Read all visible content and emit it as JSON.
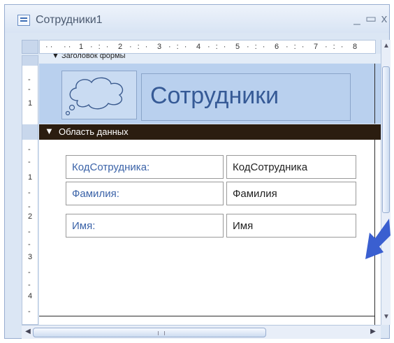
{
  "window": {
    "title": "Сотрудники1",
    "minimize_glyph": "_",
    "maximize_glyph": "▭",
    "close_glyph": "x"
  },
  "rulers": {
    "horizontal_numbers": [
      "1",
      "2",
      "3",
      "4",
      "5",
      "6",
      "7",
      "8"
    ],
    "vertical_header_numbers": [
      "1"
    ],
    "vertical_detail_numbers": [
      "1",
      "2",
      "3",
      "4"
    ]
  },
  "form_header": {
    "section_label": "▼ Заголовок формы",
    "title": "Сотрудники",
    "logo_icon": "cloud-logo-icon"
  },
  "detail_section": {
    "label": "Область данных",
    "fields": [
      {
        "label": "КодСотрудника:",
        "value": "КодСотрудника"
      },
      {
        "label": "Фамилия:",
        "value": "Фамилия"
      },
      {
        "label": "Имя:",
        "value": "Имя"
      }
    ]
  },
  "colors": {
    "header_background": "#b9d0ee",
    "section_bar": "#2b1d10",
    "label_text": "#3b63a8",
    "arrow": "#3a5fd0"
  }
}
